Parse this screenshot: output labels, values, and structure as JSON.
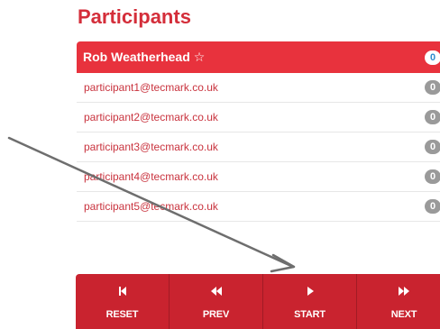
{
  "title": "Participants",
  "participants": [
    {
      "name": "Rob Weatherhead",
      "star": "☆",
      "count": "0",
      "active": true
    },
    {
      "name": "participant1@tecmark.co.uk",
      "count": "0"
    },
    {
      "name": "participant2@tecmark.co.uk",
      "count": "0"
    },
    {
      "name": "participant3@tecmark.co.uk",
      "count": "0"
    },
    {
      "name": "participant4@tecmark.co.uk",
      "count": "0"
    },
    {
      "name": "participant5@tecmark.co.uk",
      "count": "0"
    }
  ],
  "controls": [
    {
      "label": "RESET",
      "icon": "skip-back-icon"
    },
    {
      "label": "PREV",
      "icon": "rewind-icon"
    },
    {
      "label": "START",
      "icon": "play-icon"
    },
    {
      "label": "NEXT",
      "icon": "fast-forward-icon"
    }
  ],
  "colors": {
    "accent": "#e8323d",
    "button_bar": "#c9232f",
    "badge_active_text": "#2f8ccf",
    "badge_gray": "#9a9a9a"
  }
}
